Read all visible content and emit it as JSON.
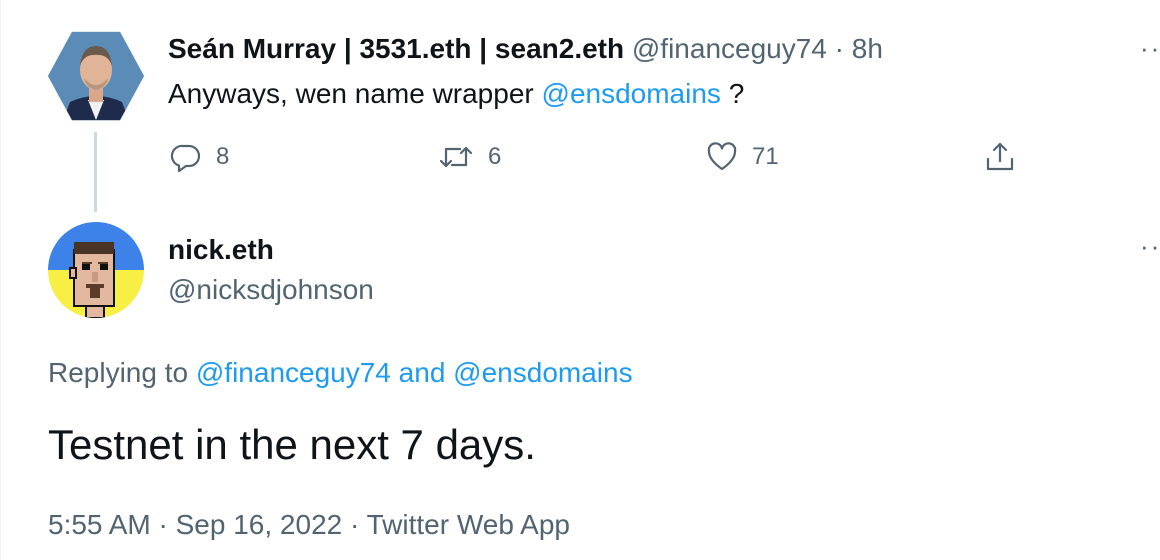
{
  "parent_tweet": {
    "author_display_name": "Seán Murray | 3531.eth | sean2.eth",
    "author_handle": "@financeguy74",
    "separator": "·",
    "time_ago": "8h",
    "text_before": "Anyways, wen name wrapper ",
    "mention": "@ensdomains",
    "text_after": " ?",
    "more_menu": "··",
    "actions": {
      "reply_icon": "reply-icon",
      "reply_count": "8",
      "retweet_icon": "retweet-icon",
      "retweet_count": "6",
      "like_icon": "heart-icon",
      "like_count": "71",
      "share_icon": "share-icon"
    }
  },
  "main_tweet": {
    "author_display_name": "nick.eth",
    "author_handle": "@nicksdjohnson",
    "more_menu": "··",
    "replying_prefix": "Replying to ",
    "replying_mention_1": "@financeguy74",
    "replying_joiner": " and ",
    "replying_mention_2": "@ensdomains",
    "text": "Testnet in the next 7 days.",
    "time": "5:55 AM",
    "separator": " · ",
    "date": "Sep 16, 2022",
    "source": "Twitter Web App"
  },
  "colors": {
    "link": "#1d9bf0",
    "secondary_text": "#536471",
    "primary_text": "#0f1419",
    "thread_line": "#cfd9de"
  }
}
